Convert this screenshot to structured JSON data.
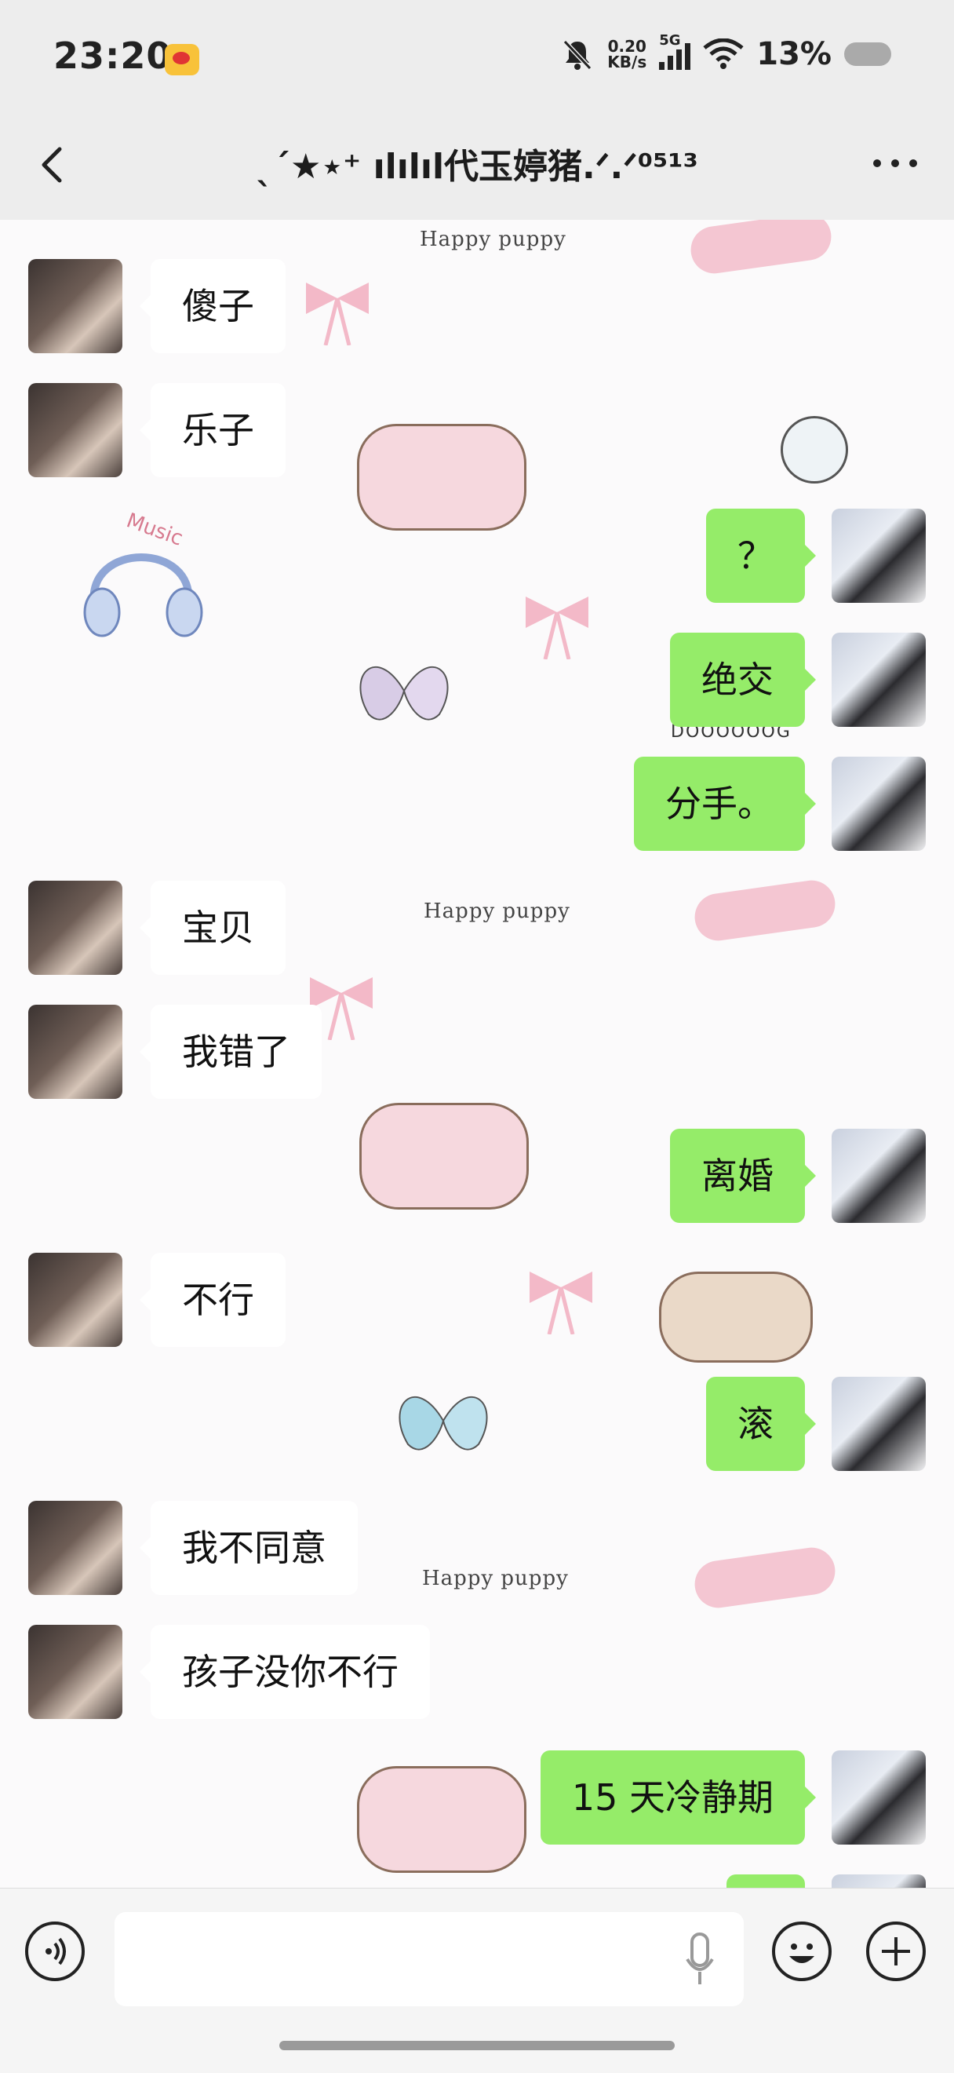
{
  "status_bar": {
    "time": "23:20",
    "speed_value": "0.20",
    "speed_unit": "KB/s",
    "network": "5G",
    "battery": "13%"
  },
  "header": {
    "title": "ˎˊ★⋆⁺ ılılıl代玉婷猪.ᐟ.ᐟ⁰⁵¹³"
  },
  "background": {
    "sticker_text": "Happy puppy",
    "music_text": "Music",
    "dog_text": "DOOOOOOG"
  },
  "messages": [
    {
      "side": "left",
      "text": "傻子"
    },
    {
      "side": "left",
      "text": "乐子"
    },
    {
      "side": "right",
      "text": "？"
    },
    {
      "side": "right",
      "text": "绝交"
    },
    {
      "side": "right",
      "text": "分手。"
    },
    {
      "side": "left",
      "text": "宝贝"
    },
    {
      "side": "left",
      "text": "我错了"
    },
    {
      "side": "right",
      "text": "离婚"
    },
    {
      "side": "left",
      "text": "不行"
    },
    {
      "side": "right",
      "text": "滚"
    },
    {
      "side": "left",
      "text": "我不同意"
    },
    {
      "side": "left",
      "text": "孩子没你不行"
    },
    {
      "side": "right",
      "text": "15 天冷静期"
    }
  ],
  "input_bar": {
    "placeholder": "",
    "icons": [
      "voice-icon",
      "mic-icon",
      "emoji-icon",
      "plus-icon"
    ]
  },
  "colors": {
    "bubble_right": "#95ec69",
    "bubble_left": "#ffffff",
    "bar_bg": "#ededed"
  }
}
